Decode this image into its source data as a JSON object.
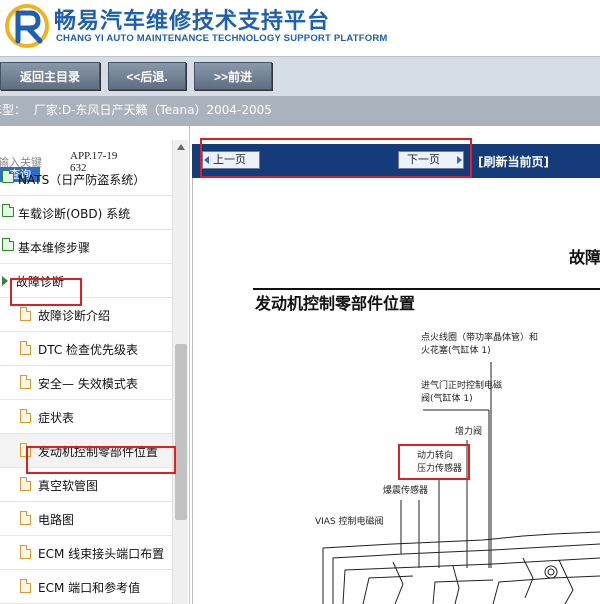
{
  "header": {
    "title_cn": "畅易汽车维修技术支持平台",
    "title_en": "CHANG YI AUTO MAINTENANCE TECHNOLOGY SUPPORT PLATFORM"
  },
  "nav": {
    "home": "返回主目录",
    "back": "<<后退.",
    "forward": ">>前进"
  },
  "vehicle": {
    "label": "车型：",
    "value": "厂家:D-东风日产天籁（Teana）2004-2005"
  },
  "sidebar": {
    "search_label": "输入关键",
    "search_button": "查询",
    "app_code": "APP.17-19632",
    "items": [
      {
        "label": "NATS（日产防盗系统）",
        "type": "folder"
      },
      {
        "label": "车载诊断(OBD) 系统",
        "type": "folder"
      },
      {
        "label": "基本维修步骤",
        "type": "folder"
      },
      {
        "label": "故障诊断",
        "type": "open-folder"
      },
      {
        "label": "故障诊断介绍",
        "type": "doc"
      },
      {
        "label": "DTC 检查优先级表",
        "type": "doc"
      },
      {
        "label": "安全— 失效模式表",
        "type": "doc"
      },
      {
        "label": "症状表",
        "type": "doc"
      },
      {
        "label": "发动机控制零部件位置",
        "type": "doc"
      },
      {
        "label": "真空软管图",
        "type": "doc"
      },
      {
        "label": "电路图",
        "type": "doc"
      },
      {
        "label": "ECM 线束接头端口布置",
        "type": "doc"
      },
      {
        "label": "ECM 端口和参考值",
        "type": "doc"
      }
    ]
  },
  "toolbar": {
    "prev": "上一页",
    "next": "下一页",
    "refresh": "[刷新当前页]"
  },
  "document": {
    "heading_right": "故障",
    "title": "发动机控制零部件位置",
    "callouts": [
      "点火线圈（带功率晶体管）和",
      "火花塞(气缸体 1)",
      "进气门正时控制电磁",
      "阀(气缸体 1)",
      "增力阀",
      "动力转向",
      "压力传感器",
      "爆震传感器",
      "VIAS 控制电磁阀"
    ]
  },
  "colors": {
    "brand_blue": "#1d5fb0",
    "toolbar_navy": "#163b7a",
    "highlight_red": "#e02020"
  }
}
